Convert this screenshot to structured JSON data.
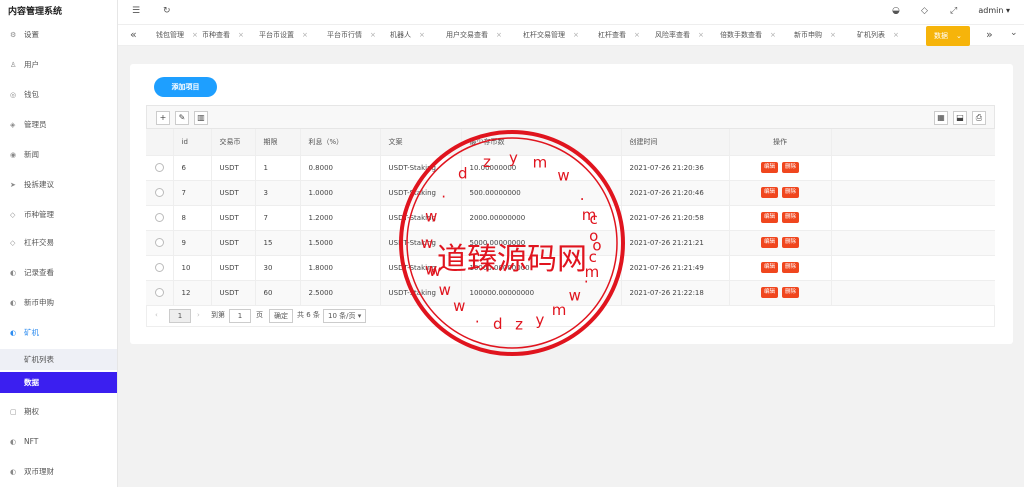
{
  "app": {
    "title": "内容管理系统"
  },
  "sidebar": {
    "items": [
      {
        "label": "设置",
        "icon": "gear-icon",
        "glyph": "⚙"
      },
      {
        "label": "用户",
        "icon": "user-icon",
        "glyph": "♙"
      },
      {
        "label": "钱包",
        "icon": "wallet-icon",
        "glyph": "◎"
      },
      {
        "label": "管理员",
        "icon": "shield-icon",
        "glyph": "◈"
      },
      {
        "label": "新闻",
        "icon": "news-icon",
        "glyph": "◉"
      },
      {
        "label": "投拆建议",
        "icon": "feedback-icon",
        "glyph": "➤"
      },
      {
        "label": "币种管理",
        "icon": "diamond-icon",
        "glyph": "◇"
      },
      {
        "label": "杠杆交易",
        "icon": "diamond-icon",
        "glyph": "◇"
      },
      {
        "label": "记录查看",
        "icon": "record-icon",
        "glyph": "◐"
      },
      {
        "label": "新币申购",
        "icon": "coin-icon",
        "glyph": "◐"
      },
      {
        "label": "矿机",
        "icon": "miner-icon",
        "glyph": "◐"
      },
      {
        "label": "期权",
        "icon": "option-icon",
        "glyph": "▢"
      },
      {
        "label": "NFT",
        "icon": "nft-icon",
        "glyph": "◐"
      },
      {
        "label": "双币理财",
        "icon": "finance-icon",
        "glyph": "◐"
      }
    ],
    "sub_items": [
      {
        "label": "矿机列表"
      },
      {
        "label": "数据"
      }
    ]
  },
  "header": {
    "user": "admin"
  },
  "tabs": [
    {
      "label": "钱包管理"
    },
    {
      "label": "币种查看"
    },
    {
      "label": "平台币设置"
    },
    {
      "label": "平台币行情"
    },
    {
      "label": "机器人"
    },
    {
      "label": "用户交易查看"
    },
    {
      "label": "杠杆交易管理"
    },
    {
      "label": "杠杆查看"
    },
    {
      "label": "风险率查看"
    },
    {
      "label": "倍数手数查看"
    },
    {
      "label": "新币申购"
    },
    {
      "label": "矿机列表"
    },
    {
      "label": "数据"
    }
  ],
  "main": {
    "add_button": "添加项目",
    "columns": [
      "id",
      "交易币",
      "期限",
      "利息（%）",
      "文案",
      "最少存币数",
      "创建时间",
      "操作"
    ],
    "rows": [
      {
        "id": "6",
        "coin": "USDT",
        "term": "1",
        "rate": "0.8000",
        "text": "USDT-Staking",
        "min": "10.00000000",
        "created": "2021-07-26 21:20:36"
      },
      {
        "id": "7",
        "coin": "USDT",
        "term": "3",
        "rate": "1.0000",
        "text": "USDT-Staking",
        "min": "500.00000000",
        "created": "2021-07-26 21:20:46"
      },
      {
        "id": "8",
        "coin": "USDT",
        "term": "7",
        "rate": "1.2000",
        "text": "USDT-Staking",
        "min": "2000.00000000",
        "created": "2021-07-26 21:20:58"
      },
      {
        "id": "9",
        "coin": "USDT",
        "term": "15",
        "rate": "1.5000",
        "text": "USDT-Staking",
        "min": "5000.00000000",
        "created": "2021-07-26 21:21:21"
      },
      {
        "id": "10",
        "coin": "USDT",
        "term": "30",
        "rate": "1.8000",
        "text": "USDT-Staking",
        "min": "10000.00000000",
        "created": "2021-07-26 21:21:49"
      },
      {
        "id": "12",
        "coin": "USDT",
        "term": "60",
        "rate": "2.5000",
        "text": "USDT-Staking",
        "min": "100000.00000000",
        "created": "2021-07-26 21:22:18"
      }
    ],
    "edit_label": "编辑",
    "delete_label": "删除"
  },
  "pager": {
    "current": "1",
    "goto_label": "到第",
    "goto_value": "1",
    "page_unit": "页",
    "confirm": "确定",
    "total": "共 6 条",
    "page_size": "10 条/页"
  },
  "watermark": {
    "main": "道臻源码网",
    "ring_text": "www.dzymw.com",
    "color": "#e0141e"
  }
}
